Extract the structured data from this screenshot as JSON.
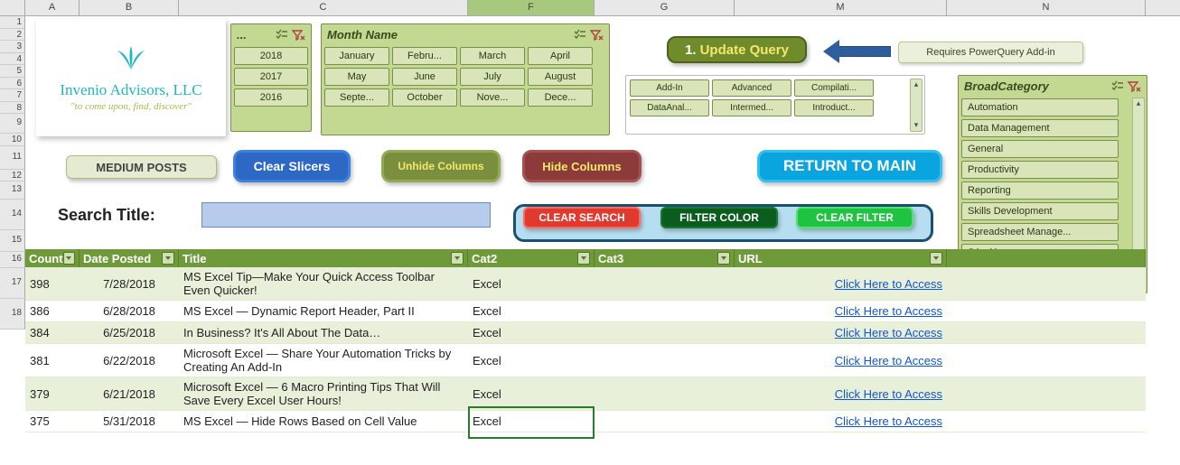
{
  "columns": [
    "A",
    "B",
    "C",
    "F",
    "G",
    "M",
    "N"
  ],
  "rows": [
    "1",
    "2",
    "3",
    "4",
    "5",
    "6",
    "7",
    "8",
    "9",
    "10",
    "11",
    "12",
    "13",
    "14",
    "15",
    "16",
    "17",
    "18"
  ],
  "logo": {
    "company": "Invenio Advisors, LLC",
    "tagline": "\"to come upon, find, discover\""
  },
  "slicers": {
    "year": {
      "title": "...",
      "items": [
        "2018",
        "2017",
        "2016"
      ]
    },
    "month": {
      "title": "Month Name",
      "items": [
        "January",
        "Febru...",
        "March",
        "April",
        "May",
        "June",
        "July",
        "August",
        "Septe...",
        "October",
        "Nove...",
        "Dece..."
      ]
    },
    "unnamed": {
      "items": [
        "Add-In",
        "Advanced",
        "Compilati...",
        "DataAnal...",
        "Intermed...",
        "Introduct..."
      ]
    },
    "broad": {
      "title": "BroadCategory",
      "items": [
        "Automation",
        "Data Management",
        "General",
        "Productivity",
        "Reporting",
        "Skills Development",
        "Spreadsheet Manage...",
        "(blank)"
      ]
    }
  },
  "buttons": {
    "update_num": "1.",
    "update": "Update Query",
    "powerquery_note": "Requires PowerQuery Add-in",
    "medium": "MEDIUM POSTS",
    "clear_slicers": "Clear Slicers",
    "unhide": "Unhide Columns",
    "hide": "Hide Columns",
    "return": "RETURN TO MAIN",
    "clear_search": "CLEAR SEARCH",
    "filter_color": "FILTER COLOR",
    "clear_filter": "CLEAR FILTER"
  },
  "search_label": "Search Title:",
  "table": {
    "headers": {
      "count": "Count",
      "date": "Date Posted",
      "title": "Title",
      "cat2": "Cat2",
      "cat3": "Cat3",
      "url": "URL"
    },
    "link_text": "Click Here to Access",
    "rows": [
      {
        "count": "398",
        "date": "7/28/2018",
        "title": "MS Excel Tip—Make Your Quick Access Toolbar Even Quicker!",
        "cat2": "Excel",
        "alt": true,
        "tall": true
      },
      {
        "count": "386",
        "date": "6/28/2018",
        "title": "MS Excel — Dynamic Report Header, Part II",
        "cat2": "Excel",
        "alt": false
      },
      {
        "count": "384",
        "date": "6/25/2018",
        "title": "In Business? It's All About The Data…",
        "cat2": "Excel",
        "alt": true
      },
      {
        "count": "381",
        "date": "6/22/2018",
        "title": "Microsoft Excel — Share Your Automation Tricks by Creating An Add-In",
        "cat2": "Excel",
        "alt": false,
        "tall": true
      },
      {
        "count": "379",
        "date": "6/21/2018",
        "title": "Microsoft Excel — 6 Macro Printing Tips That Will Save Every Excel User Hours!",
        "cat2": "Excel",
        "alt": true,
        "tall": true
      },
      {
        "count": "375",
        "date": "5/31/2018",
        "title": "MS Excel — Hide Rows Based on Cell Value",
        "cat2": "Excel",
        "alt": false
      }
    ]
  }
}
